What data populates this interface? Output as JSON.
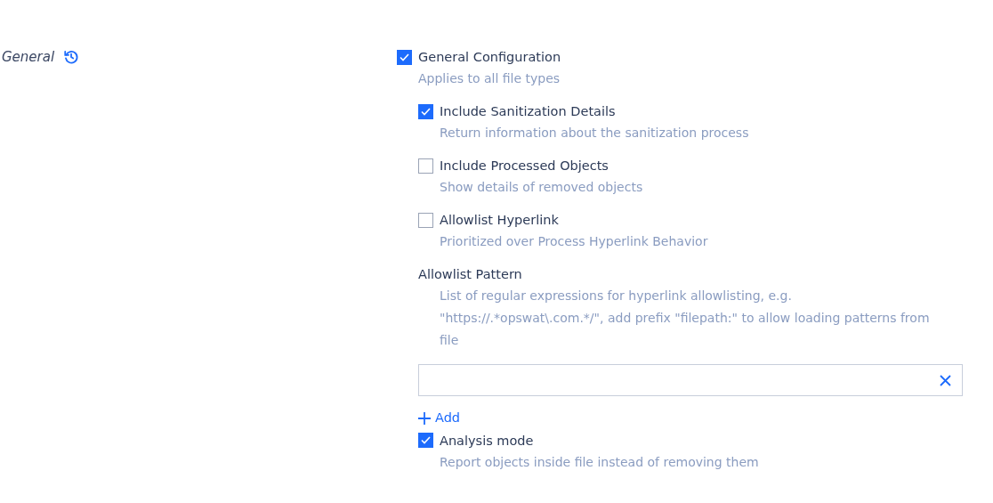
{
  "section": {
    "title": "General"
  },
  "main": {
    "label": "General Configuration",
    "description": "Applies to all file types",
    "checked": true,
    "children": [
      {
        "kind": "checkbox",
        "label": "Include Sanitization Details",
        "description": "Return information about the sanitization process",
        "checked": true
      },
      {
        "kind": "checkbox",
        "label": "Include Processed Objects",
        "description": "Show details of removed objects",
        "checked": false
      },
      {
        "kind": "checkbox",
        "label": "Allowlist Hyperlink",
        "description": "Prioritized over Process Hyperlink Behavior",
        "checked": false
      },
      {
        "kind": "pattern",
        "label": "Allowlist Pattern",
        "description": "List of regular expressions for hyperlink allowlisting, e.g. \"https://.*opswat\\.com.*/\", add prefix \"filepath:\" to allow loading patterns from file",
        "add_label": "Add"
      },
      {
        "kind": "checkbox",
        "label": "Analysis mode",
        "description": "Report objects inside file instead of removing them",
        "checked": true
      }
    ]
  }
}
